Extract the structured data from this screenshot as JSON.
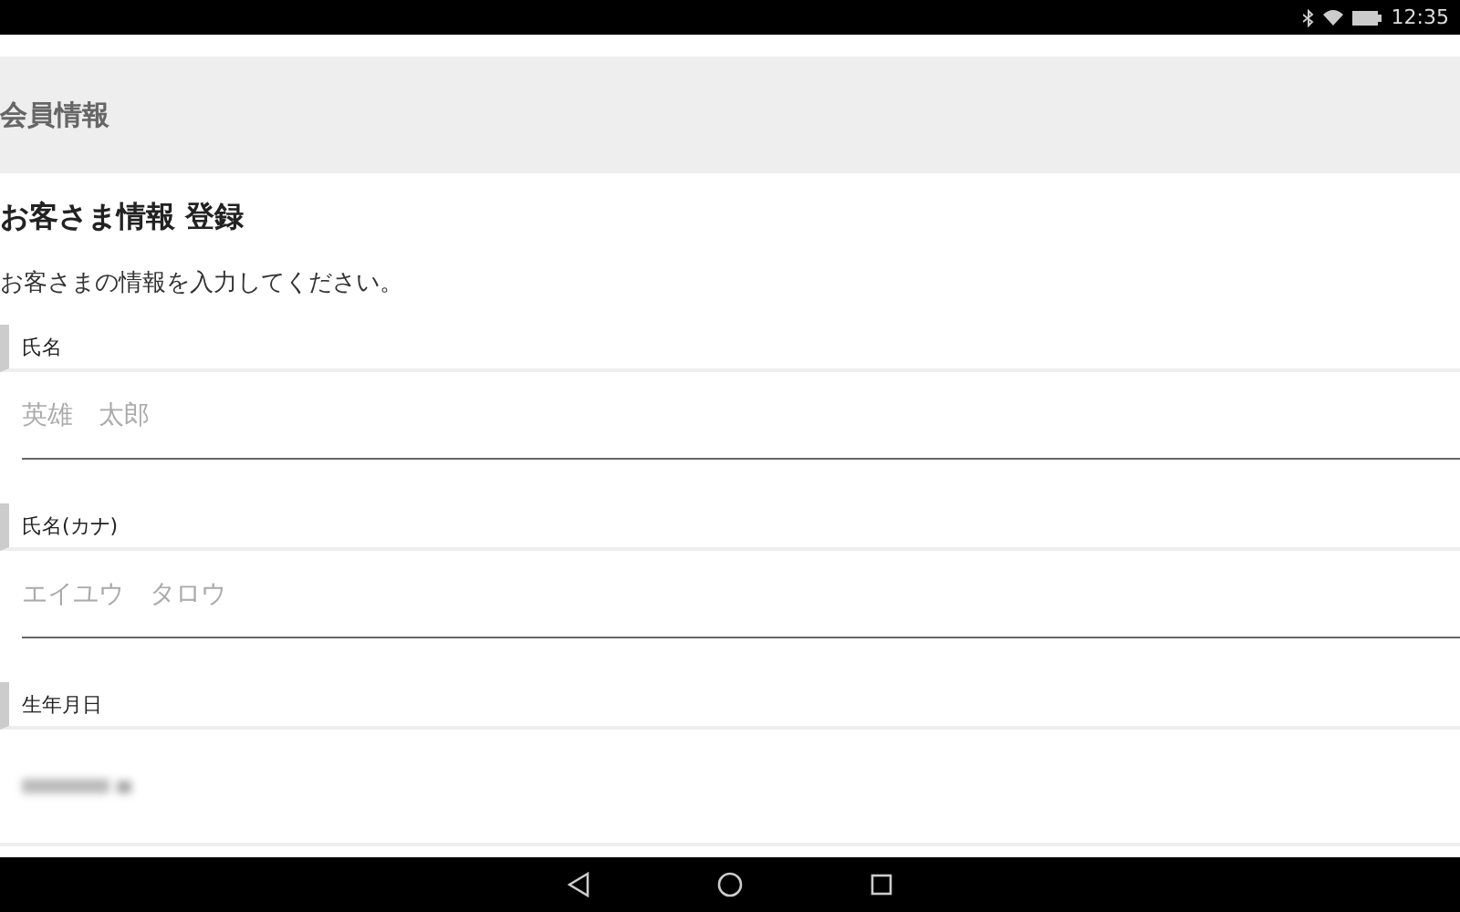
{
  "status_bar": {
    "time": "12:35"
  },
  "header": {
    "title": "会員情報"
  },
  "form": {
    "title": "お客さま情報 登録",
    "description": "お客さまの情報を入力してください。",
    "fields": [
      {
        "label": "氏名",
        "kind": "text",
        "placeholder": "英雄　太郎"
      },
      {
        "label": "氏名(カナ)",
        "kind": "text",
        "placeholder": "エイユウ　タロウ"
      },
      {
        "label": "生年月日",
        "kind": "blurred"
      }
    ]
  }
}
